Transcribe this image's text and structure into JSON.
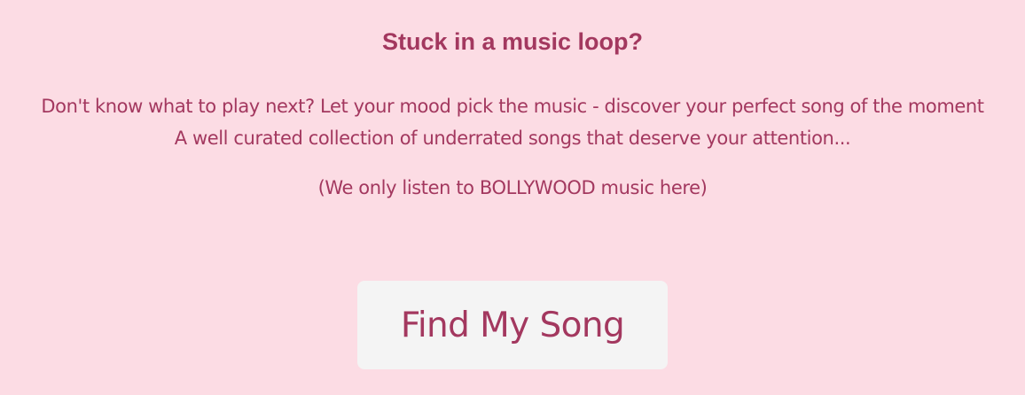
{
  "header": {
    "title": "Stuck in a music loop?"
  },
  "intro": {
    "line1": "Don't know what to play next? Let your mood pick the music - discover your perfect song of the moment",
    "line2": "A well curated collection of underrated songs that deserve your attention..."
  },
  "note": "(We only listen to BOLLYWOOD music here)",
  "actions": {
    "find_song_label": "Find My Song"
  },
  "colors": {
    "background": "#fcdce4",
    "text": "#a3385f",
    "button_background": "#f4f4f4"
  }
}
